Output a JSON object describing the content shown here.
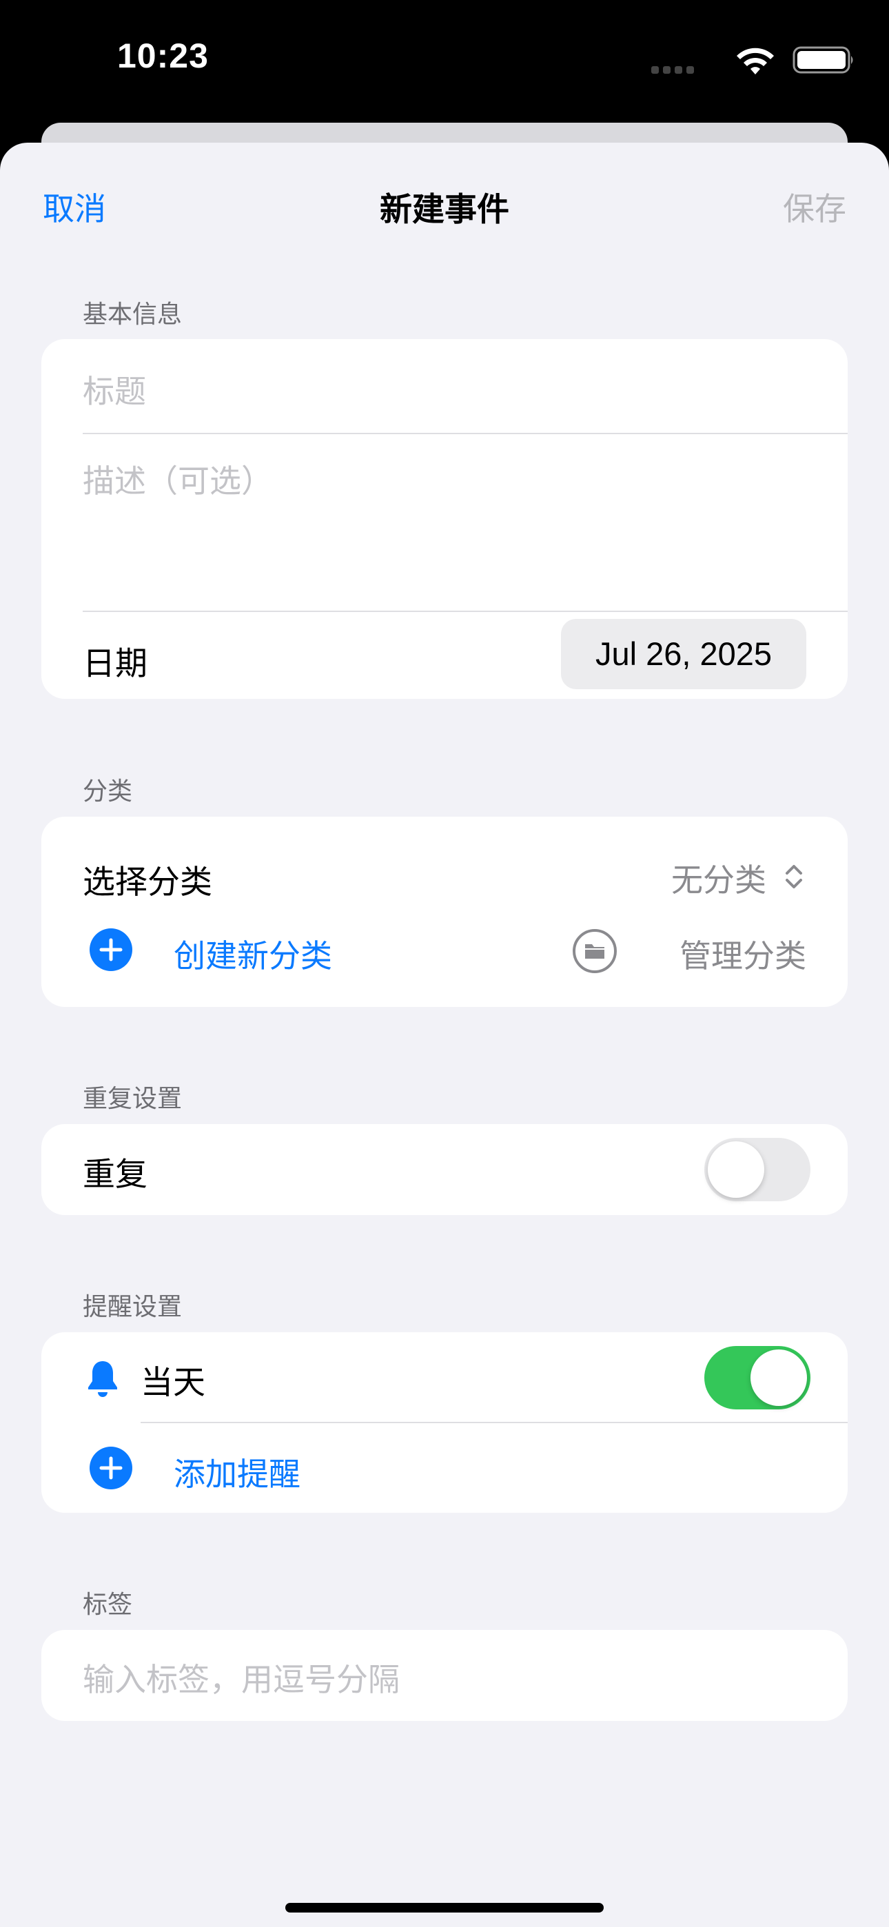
{
  "status": {
    "time": "10:23"
  },
  "nav": {
    "cancel": "取消",
    "title": "新建事件",
    "save": "保存"
  },
  "basic": {
    "header": "基本信息",
    "title_placeholder": "标题",
    "desc_placeholder": "描述（可选）",
    "date_label": "日期",
    "date_value": "Jul 26, 2025"
  },
  "category": {
    "header": "分类",
    "select_label": "选择分类",
    "select_value": "无分类",
    "create_label": "创建新分类",
    "manage_label": "管理分类"
  },
  "repeat": {
    "header": "重复设置",
    "label": "重复",
    "enabled": false
  },
  "reminder": {
    "header": "提醒设置",
    "item_label": "当天",
    "item_enabled": true,
    "add_label": "添加提醒"
  },
  "tags": {
    "header": "标签",
    "placeholder": "输入标签，用逗号分隔"
  },
  "colors": {
    "accent": "#0a7aff",
    "toggle_on": "#34c759",
    "toggle_off": "#e9e9eb"
  }
}
